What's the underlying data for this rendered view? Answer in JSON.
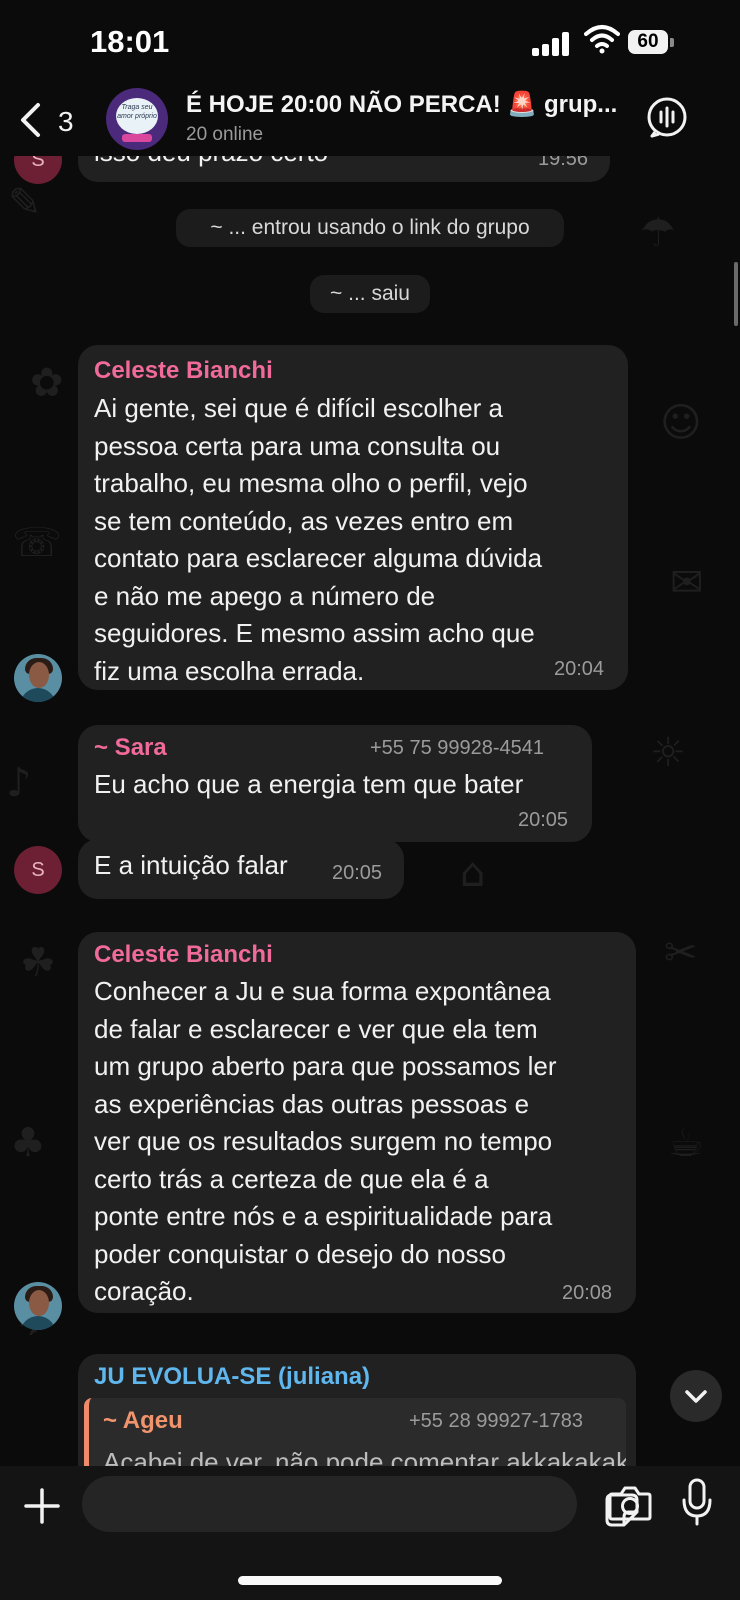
{
  "status_bar": {
    "time": "18:01",
    "battery": "60"
  },
  "header": {
    "back_count": "3",
    "group_avatar_text": "Traga seu amor próprio",
    "title": "É HOJE 20:00 NÃO PERCA! 🚨 grup...",
    "subtitle": "20 online"
  },
  "messages": {
    "m0": {
      "avatar": "S",
      "text": "isso deu prazo certo",
      "time": "19:56"
    },
    "sys1": "~ ... entrou usando o link do grupo",
    "sys2": "~ ... saiu",
    "m1": {
      "sender": "Celeste Bianchi",
      "lines": [
        "Ai gente, sei que é difícil escolher a",
        "pessoa certa para uma consulta ou",
        "trabalho, eu mesma olho o perfil, vejo",
        "se tem conteúdo, as vezes entro em",
        "contato para esclarecer alguma dúvida",
        "e não me apego a número de",
        "seguidores. E mesmo assim acho que",
        "fiz uma escolha errada."
      ],
      "time": "20:04"
    },
    "m2": {
      "sender": "~ Sara",
      "phone": "+55 75 99928-4541",
      "text": "Eu acho que a energia tem que bater",
      "time": "20:05"
    },
    "m3": {
      "avatar": "S",
      "text": "E a intuição falar",
      "time": "20:05"
    },
    "m4": {
      "sender": "Celeste Bianchi",
      "lines": [
        "Conhecer a Ju e sua forma expontânea",
        "de falar e esclarecer e ver que ela tem",
        "um grupo aberto para que possamos ler",
        "as experiências das outras pessoas e",
        "ver que os resultados surgem no tempo",
        "certo trás a certeza de que ela é a",
        "ponte entre nós e a espiritualidade para",
        "poder conquistar o desejo do nosso",
        "coração."
      ],
      "time": "20:08"
    },
    "m5": {
      "sender": "JU EVOLUA-SE (juliana)",
      "quote_sender": "~ Ageu",
      "quote_phone": "+55 28 99927-1783",
      "quote_text": "Acabei de ver, não pode comentar akkakakak"
    }
  },
  "colors": {
    "pink_sender": "#f06a9a",
    "blue_sender": "#5fb7ee",
    "orange_sender": "#f0946e"
  }
}
